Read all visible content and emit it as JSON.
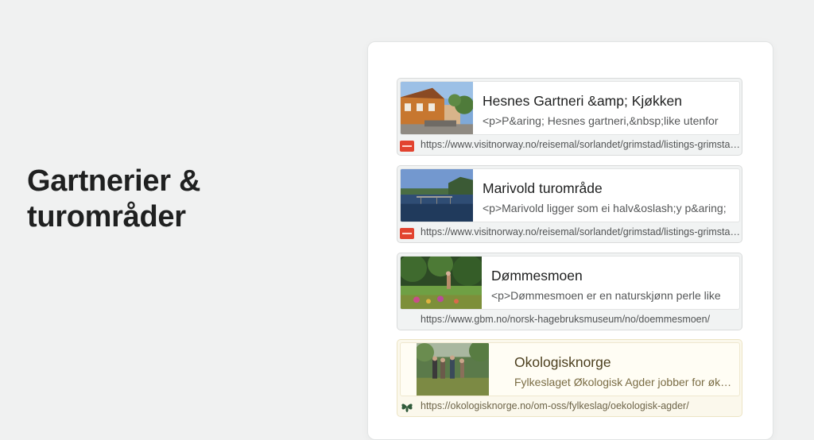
{
  "heading": {
    "line1": "Gartnerier &",
    "line2": "turområder"
  },
  "results": [
    {
      "title": "Hesnes Gartneri &amp; Kjøkken",
      "snippet": "<p>P&aring; Hesnes gartneri,&nbsp;like utenfor",
      "url": "https://www.visitnorway.no/reisemal/sorlandet/grimstad/listings-grimstad/hesnes-gartneri",
      "favicon": "visitnorway-icon"
    },
    {
      "title": "Marivold turområde",
      "snippet": "<p>Marivold ligger som ei halv&oslash;y p&aring;",
      "url": "https://www.visitnorway.no/reisemal/sorlandet/grimstad/listings-grimstad/marivold",
      "favicon": "visitnorway-icon"
    },
    {
      "title": "Dømmesmoen",
      "snippet": "<p>Dømmesmoen er en naturskjønn perle like",
      "url": "https://www.gbm.no/norsk-hagebruksmuseum/no/doemmesmoen/",
      "favicon": ""
    },
    {
      "title": "Okologisknorge",
      "snippet": "Fylkeslaget Økologisk Agder jobber for økologisk",
      "url": "https://okologisknorge.no/om-oss/fylkeslag/oekologisk-agder/",
      "favicon": "leaf-icon"
    }
  ],
  "colors": {
    "background": "#f0f1f1",
    "highlight": "#fbf8ec",
    "favicon_red": "#e2432f",
    "leaf_green": "#2f5a3a"
  }
}
